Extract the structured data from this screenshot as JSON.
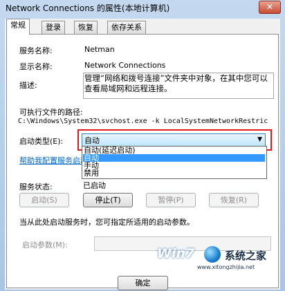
{
  "window": {
    "title": "Network Connections 的属性(本地计算机)",
    "close_label": "✕"
  },
  "tabs": [
    "常规",
    "登录",
    "恢复",
    "依存关系"
  ],
  "general": {
    "service_name_label": "服务名称:",
    "service_name_value": "Netman",
    "display_name_label": "显示名称:",
    "display_name_value": "Network Connections",
    "description_label": "描述:",
    "description_value": "管理“网络和拨号连接”文件夹中对象，在其中您可以查看局域网和远程连接。",
    "exe_path_label": "可执行文件的路径:",
    "exe_path_value": "C:\\Windows\\System32\\svchost.exe -k LocalSystemNetworkRestric",
    "startup_type_label": "启动类型(E):",
    "startup_type_value": "自动",
    "startup_options": [
      "自动(延迟启动)",
      "自动",
      "手动",
      "禁用"
    ],
    "startup_selected_index": 1,
    "help_link": "帮助我配置服务启动",
    "service_status_label": "服务状态:",
    "service_status_value": "已启动",
    "buttons": {
      "start": "启动(S)",
      "stop": "停止(T)",
      "pause": "暂停(P)",
      "resume": "恢复(R)"
    },
    "start_params_hint": "当从此处启动服务时，您可指定所适用的启动参数。",
    "start_params_label": "启动参数(M):",
    "start_params_value": ""
  },
  "footer": {
    "ok_label": "确定"
  },
  "watermark": {
    "logo_text": "Win7",
    "site_text": "系统之家",
    "url_text": "www.xitongzhijia.net"
  },
  "colors": {
    "highlight": "#3399ff",
    "link": "#0066cc",
    "red_annotation": "#e0191f"
  }
}
